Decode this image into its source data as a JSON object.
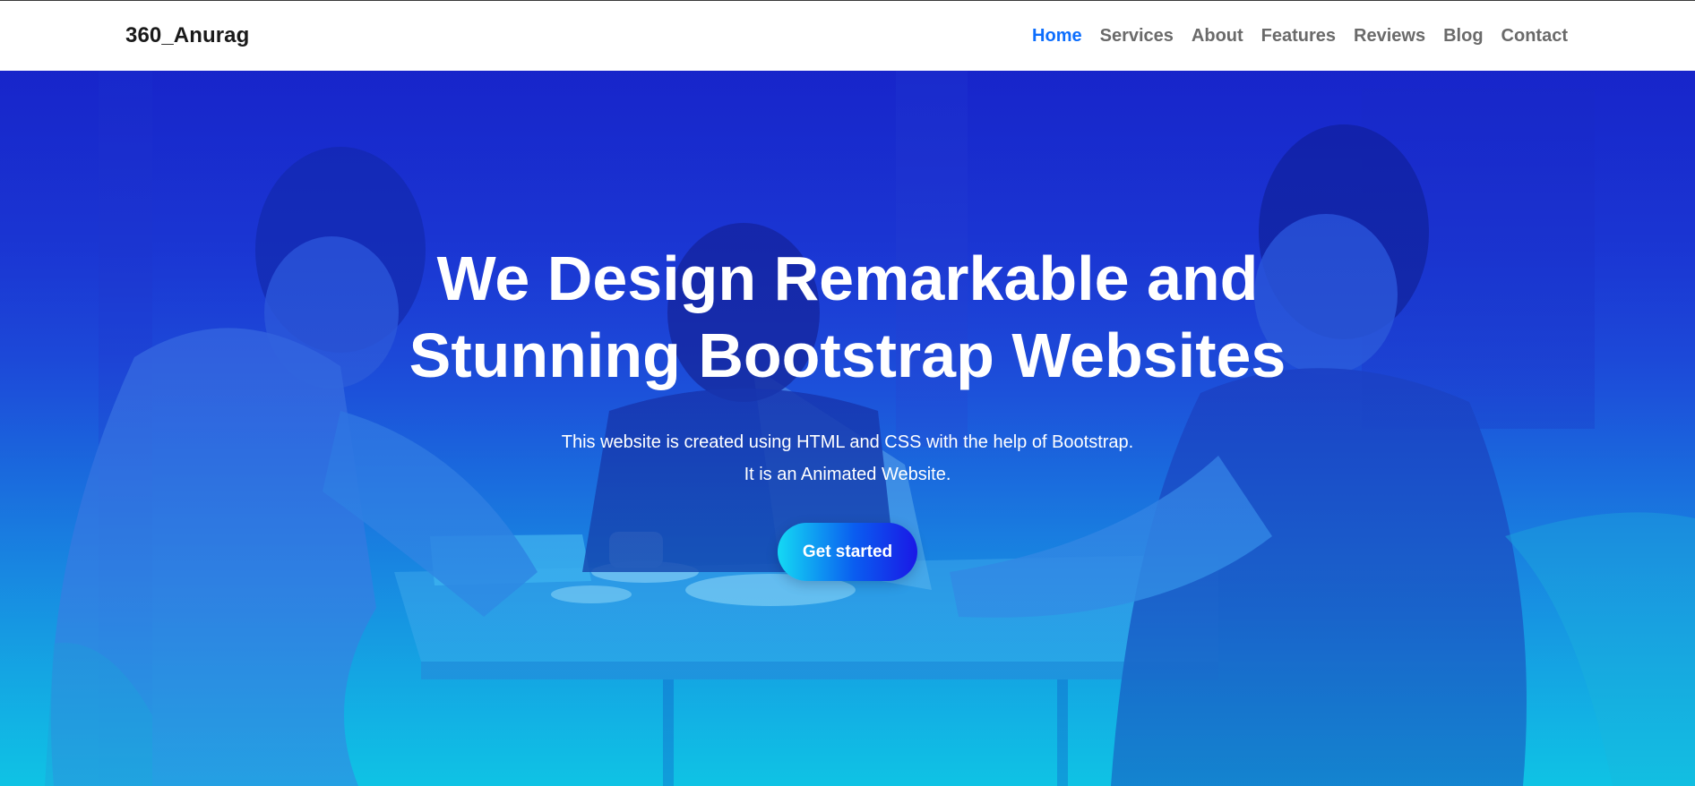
{
  "navbar": {
    "brand": "360_Anurag",
    "links": [
      {
        "label": "Home",
        "active": true
      },
      {
        "label": "Services"
      },
      {
        "label": "About"
      },
      {
        "label": "Features"
      },
      {
        "label": "Reviews"
      },
      {
        "label": "Blog"
      },
      {
        "label": "Contact"
      }
    ],
    "active_color": "#0d6efd"
  },
  "hero": {
    "title_line1": "We Design Remarkable and",
    "title_line2": "Stunning Bootstrap Websites",
    "subtitle_line1": "This website is created using HTML and CSS with the help of Bootstrap.",
    "subtitle_line2": "It is an Animated Website.",
    "cta_label": "Get started",
    "gradient_top": "#1a29c4",
    "gradient_bottom": "#13bfe3"
  }
}
